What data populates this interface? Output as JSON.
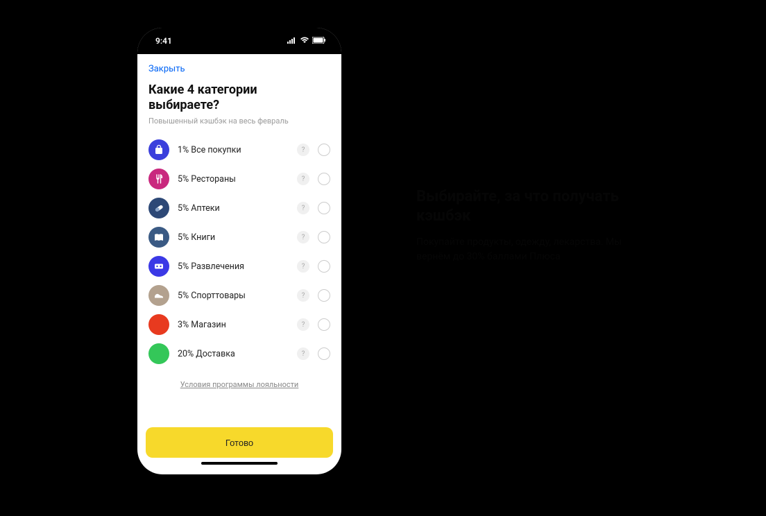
{
  "status": {
    "time": "9:41"
  },
  "nav": {
    "close": "Закрыть"
  },
  "header": {
    "title": "Какие 4 категории выбираете?",
    "subtitle": "Повышенный кэшбэк на весь февраль"
  },
  "categories": [
    {
      "label": "1% Все покупки",
      "bg": "#3b3fdc",
      "icon": "bag"
    },
    {
      "label": "5% Рестораны",
      "bg": "#c9287e",
      "icon": "fork"
    },
    {
      "label": "5% Аптеки",
      "bg": "#2d4876",
      "icon": "pill"
    },
    {
      "label": "5% Книги",
      "bg": "#3a5a84",
      "icon": "book"
    },
    {
      "label": "5% Развлечения",
      "bg": "#3b39e6",
      "icon": "ticket"
    },
    {
      "label": "5% Спорттовары",
      "bg": "#b3a18e",
      "icon": "shoe"
    },
    {
      "label": "3% Магазин",
      "bg": "#e83a1f",
      "icon": "none"
    },
    {
      "label": "20% Доставка",
      "bg": "#34c759",
      "icon": "none"
    }
  ],
  "help_symbol": "?",
  "terms": {
    "label": "Условия программы лояльности"
  },
  "footer": {
    "done": "Готово"
  },
  "promo": {
    "heading": "Выбирайте, за что получать кэшбэк",
    "body": "Покупайте продукты, одежду, лекарства. Мы вернём до 30% баллами Плюса"
  }
}
